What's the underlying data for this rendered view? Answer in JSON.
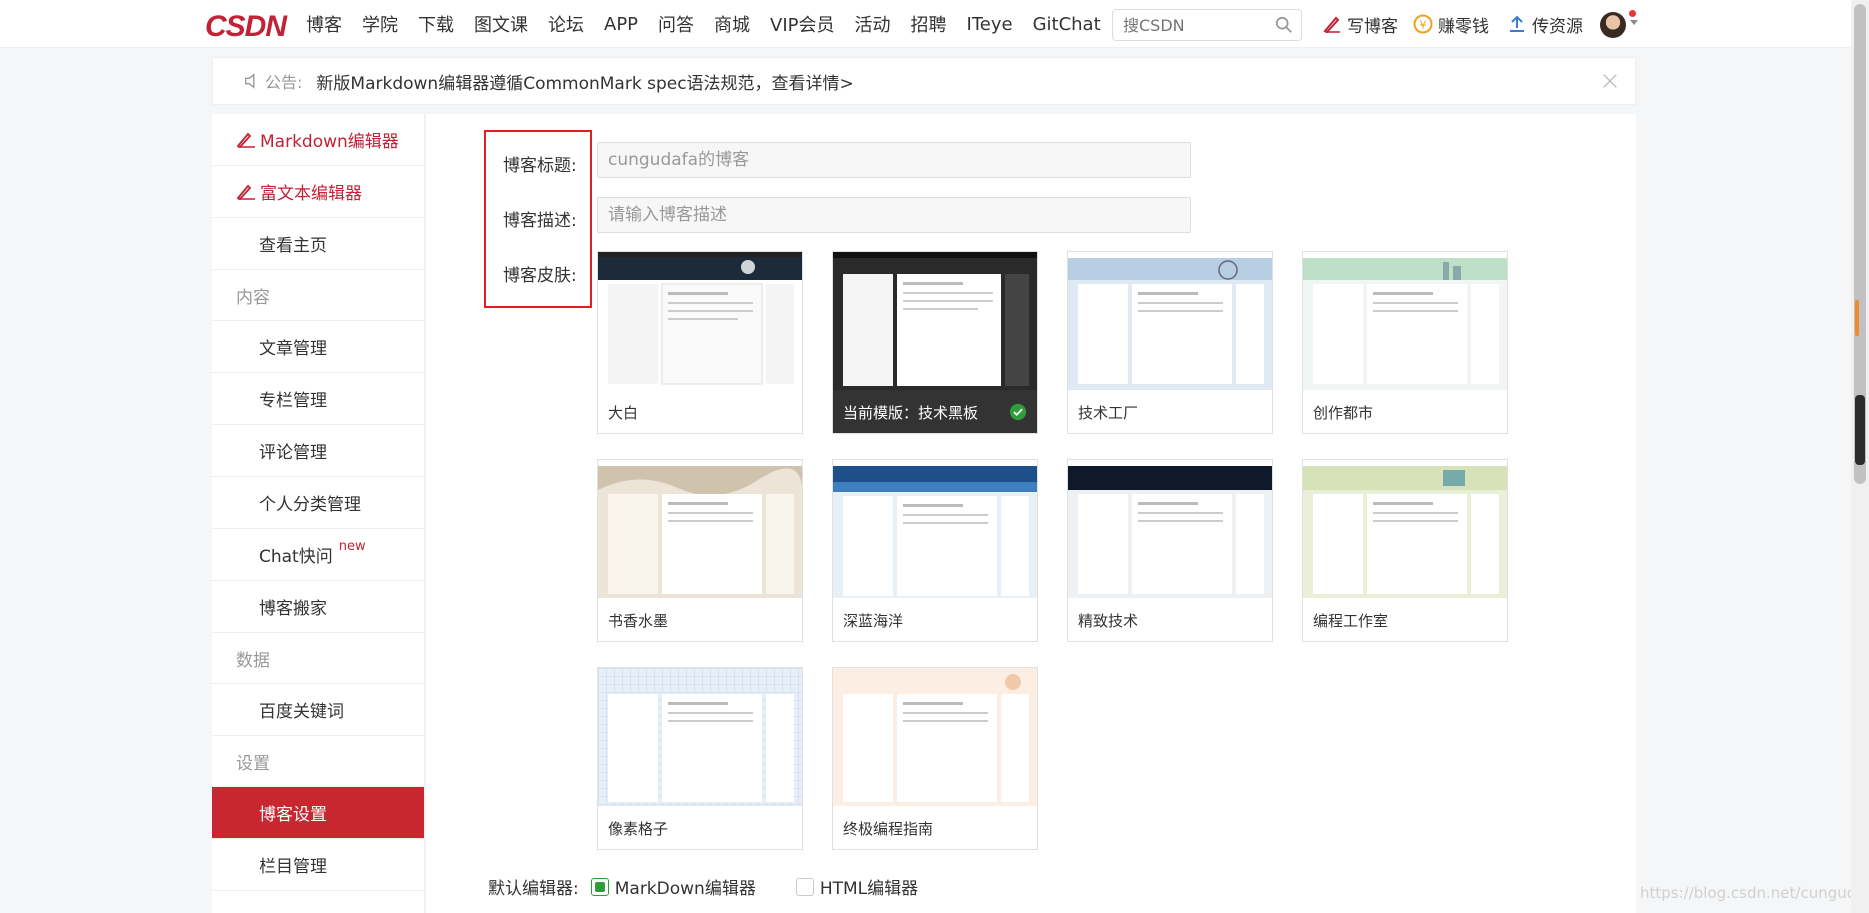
{
  "topbar": {
    "logo": "CSDN",
    "nav": [
      "博客",
      "学院",
      "下载",
      "图文课",
      "论坛",
      "APP",
      "问答",
      "商城",
      "VIP会员",
      "活动",
      "招聘",
      "ITeye",
      "GitChat"
    ],
    "search_placeholder": "搜CSDN",
    "actions": {
      "write": "写博客",
      "earn": "赚零钱",
      "upload": "传资源"
    }
  },
  "notice": {
    "label": "公告:",
    "text": "新版Markdown编辑器遵循CommonMark spec语法规范，查看详情>"
  },
  "sidebar": {
    "editors": [
      "Markdown编辑器",
      "富文本编辑器"
    ],
    "home": "查看主页",
    "section_content": "内容",
    "content_items": [
      "文章管理",
      "专栏管理",
      "评论管理",
      "个人分类管理",
      "Chat快问",
      "博客搬家"
    ],
    "new_badge": "new",
    "section_data": "数据",
    "data_items": [
      "百度关键词"
    ],
    "section_settings": "设置",
    "settings_items": [
      "博客设置",
      "栏目管理"
    ]
  },
  "form": {
    "title_label": "博客标题:",
    "title_value": "cungudafa的博客",
    "desc_label": "博客描述:",
    "desc_placeholder": "请输入博客描述",
    "skin_label": "博客皮肤:"
  },
  "skins": {
    "current_prefix": "当前模版：",
    "items": [
      "大白",
      "技术黑板",
      "技术工厂",
      "创作都市",
      "书香水墨",
      "深蓝海洋",
      "精致技术",
      "编程工作室",
      "像素格子",
      "终极编程指南"
    ]
  },
  "editor_setting": {
    "label": "默认编辑器:",
    "markdown": "MarkDown编辑器",
    "html": "HTML编辑器"
  },
  "watermark": "https://blog.csdn.net/cungudafa",
  "colors": {
    "brand": "#c32136",
    "active": "#c8272f",
    "check": "#2e9e3a"
  }
}
